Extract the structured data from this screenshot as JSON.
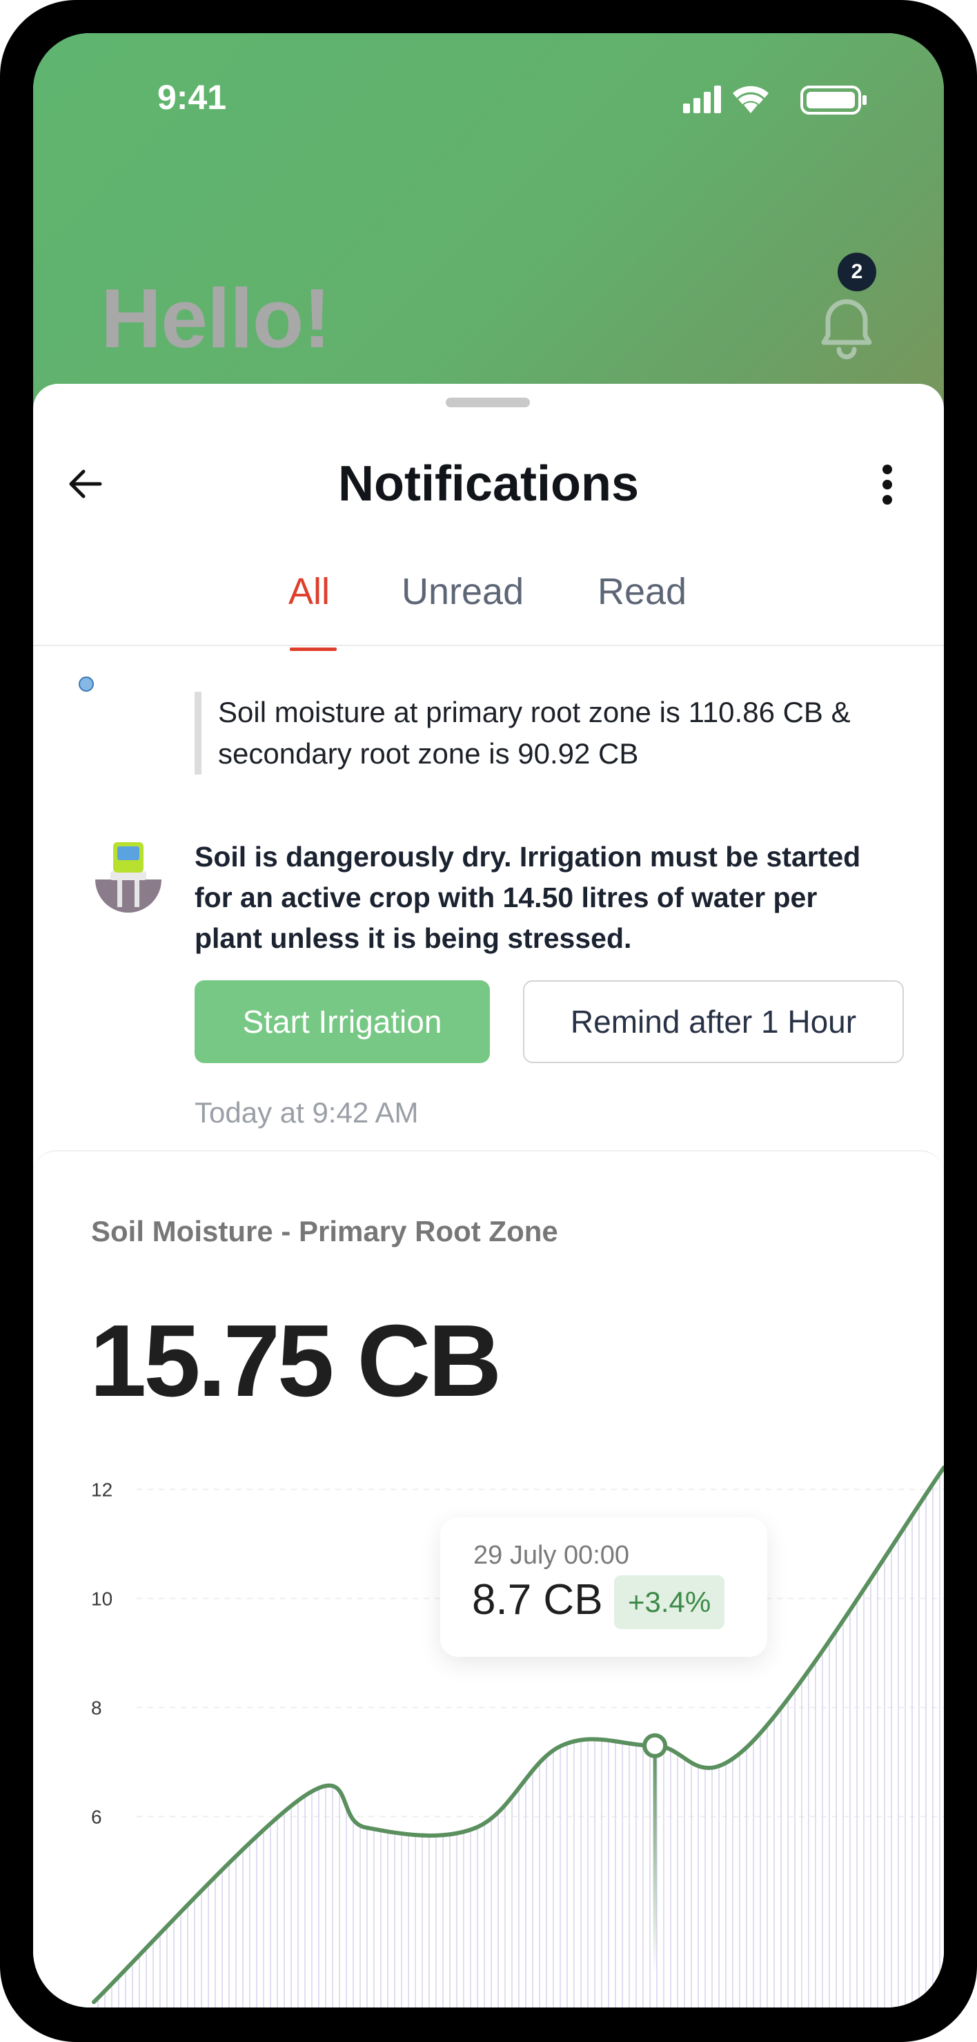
{
  "status_bar": {
    "time": "9:41"
  },
  "header": {
    "greeting": "Hello!",
    "notification_count": "2",
    "icons": [
      "bell-icon"
    ]
  },
  "sheet": {
    "title": "Notifications",
    "icons": [
      "back-arrow-icon",
      "more-vertical-icon"
    ]
  },
  "tabs": [
    {
      "label": "All",
      "active": true
    },
    {
      "label": "Unread",
      "active": false
    },
    {
      "label": "Read",
      "active": false
    }
  ],
  "notification": {
    "quote": "Soil moisture at primary root zone is 110.86 CB & secondary root zone is 90.92 CB",
    "message": "Soil is dangerously dry. Irrigation must be started for an active crop with 14.50 litres of water per plant unless it is being stressed.",
    "primary_action": "Start Irrigation",
    "secondary_action": "Remind after 1 Hour",
    "timestamp": "Today at 9:42 AM",
    "icon": "soil-sensor-icon"
  },
  "card": {
    "label": "Soil Moisture - Primary Root Zone",
    "value": "15.75 CB"
  },
  "tooltip": {
    "date": "29 July 00:00",
    "value": "8.7 CB",
    "change": "+3.4%"
  },
  "colors": {
    "accent": "#de3f2c",
    "brand_green": "#5fb56f",
    "line_green": "#5a8f5e",
    "button_green": "#77c884"
  },
  "chart_data": {
    "type": "area",
    "yticks": [
      "12",
      "10",
      "8",
      "6"
    ],
    "ylim": [
      2.5,
      12.5
    ],
    "xlim": [
      0,
      10
    ],
    "points": [
      [
        0,
        2.6
      ],
      [
        2.5,
        6.4
      ],
      [
        3.2,
        5.8
      ],
      [
        4.5,
        5.8
      ],
      [
        5.5,
        7.3
      ],
      [
        6.6,
        7.3
      ],
      [
        7.7,
        7.3
      ],
      [
        10,
        12.4
      ]
    ],
    "highlight": {
      "x": 6.6,
      "y": 7.3
    }
  }
}
